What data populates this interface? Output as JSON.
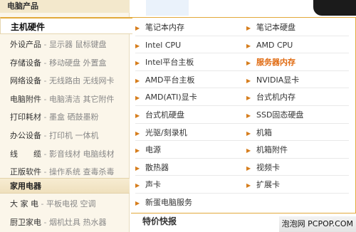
{
  "top_category": "电脑产品",
  "active_category": "主机硬件",
  "left_rows": [
    {
      "name": "外设产品",
      "subs": [
        "显示器",
        "鼠标键盘"
      ]
    },
    {
      "name": "存储设备",
      "subs": [
        "移动硬盘",
        "外置盒"
      ]
    },
    {
      "name": "网络设备",
      "subs": [
        "无线路由",
        "无线网卡"
      ]
    },
    {
      "name": "电脑附件",
      "subs": [
        "电脑清洁",
        "其它附件"
      ]
    },
    {
      "name": "打印耗材",
      "subs": [
        "墨盒",
        "硒鼓墨粉"
      ]
    },
    {
      "name": "办公设备",
      "subs": [
        "打印机",
        "一体机"
      ]
    },
    {
      "name": "线　　缆",
      "subs": [
        "影音线材",
        "电脑线材"
      ]
    },
    {
      "name": "正版软件",
      "subs": [
        "操作系统",
        "查毒杀毒"
      ]
    }
  ],
  "home_category": "家用电器",
  "home_rows": [
    {
      "name": "大 家 电",
      "subs": [
        "平板电视",
        "空调"
      ]
    },
    {
      "name": "厨卫家电",
      "subs": [
        "烟机灶具",
        "热水器"
      ]
    }
  ],
  "flyout_left": [
    "笔记本内存",
    "Intel CPU",
    "Intel平台主板",
    "AMD平台主板",
    "AMD(ATI)显卡",
    "台式机硬盘",
    "光驱/刻录机",
    "电源",
    "散热器",
    "声卡",
    "新蛋电脑服务"
  ],
  "flyout_right": [
    "笔记本硬盘",
    "AMD CPU",
    "服务器内存",
    "NVIDIA显卡",
    "台式机内存",
    "SSD固态硬盘",
    "机箱",
    "机箱附件",
    "视频卡",
    "扩展卡"
  ],
  "highlight_item": "服务器内存",
  "news_title": "特价快报",
  "footer_tag": "泡泡网 PCPOP.COM",
  "colors": {
    "accent": "#e2a93b",
    "highlight": "#e06a10",
    "panel_bg": "#fbf6ea"
  }
}
